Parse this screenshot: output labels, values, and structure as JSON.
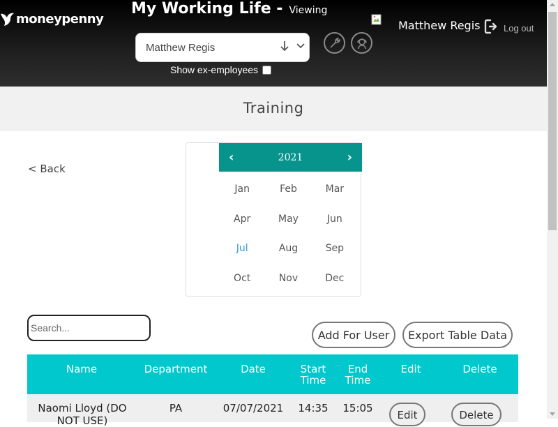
{
  "header": {
    "logo_text": "moneypenny",
    "app_title": "My Working Life -",
    "app_subtitle": "Viewing",
    "user_select": {
      "value": "Matthew Regis"
    },
    "show_ex_employees_label": "Show ex-employees",
    "show_ex_employees_checked": false,
    "user_name": "Matthew Regis",
    "logout_label": "Log out",
    "icons": [
      "wrench-icon",
      "support-icon",
      "broken-image-icon",
      "logout-icon"
    ]
  },
  "page": {
    "title": "Training",
    "back_label": "< Back"
  },
  "calendar": {
    "year": "2021",
    "prev_glyph": "‹",
    "next_glyph": "›",
    "months": [
      "Jan",
      "Feb",
      "Mar",
      "Apr",
      "May",
      "Jun",
      "Jul",
      "Aug",
      "Sep",
      "Oct",
      "Nov",
      "Dec"
    ],
    "current_month": "Jul",
    "header_color": "#07948d",
    "current_color": "#3a9bd9"
  },
  "toolbar": {
    "search_placeholder": "Search...",
    "add_for_user_label": "Add For User",
    "export_label": "Export Table Data"
  },
  "table": {
    "header_color": "#00c8cc",
    "columns": [
      "Name",
      "Department",
      "Date",
      "Start Time",
      "End Time",
      "Edit",
      "Delete"
    ],
    "rows": [
      {
        "name": "Naomi Lloyd (DO NOT USE)",
        "department": "PA",
        "date": "07/07/2021",
        "start_time": "14:35",
        "end_time": "15:05",
        "edit_label": "Edit",
        "delete_label": "Delete"
      }
    ]
  }
}
